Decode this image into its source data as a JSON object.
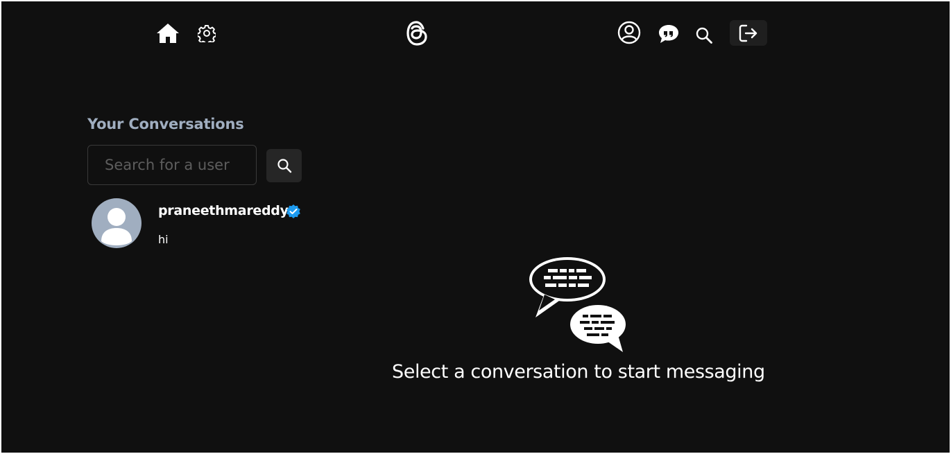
{
  "navbar": {
    "icons": [
      "home-icon",
      "gear-icon",
      "threads-logo",
      "user-icon",
      "chat-icon",
      "search-icon",
      "logout-icon"
    ]
  },
  "sidebar": {
    "title": "Your Conversations",
    "search": {
      "placeholder": "Search for a user",
      "value": ""
    },
    "conversations": [
      {
        "username": "praneethmareddy",
        "verified": true,
        "last_message": "hi"
      }
    ]
  },
  "main": {
    "empty_state_text": "Select a conversation to start messaging"
  },
  "colors": {
    "background": "#101010",
    "title": "#a0aec0",
    "verified_badge": "#1d9bf0",
    "button_bg": "#262626"
  }
}
